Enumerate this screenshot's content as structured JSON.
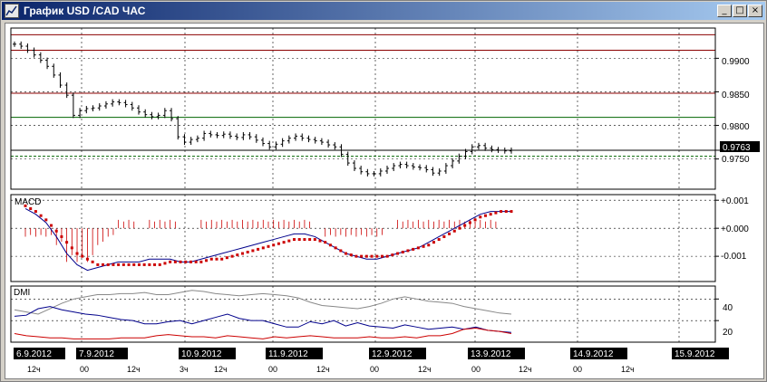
{
  "window": {
    "title": "График USD /CAD  ЧАС",
    "icons": [
      "chart-app-icon",
      "minimize-icon",
      "maximize-icon",
      "close-icon"
    ],
    "buttons": {
      "minimize": "_",
      "maximize": "□",
      "close": "×"
    }
  },
  "colors": {
    "titlebar_start": "#0a246a",
    "titlebar_end": "#a6caf0",
    "candle": "#000000",
    "resistance_line": "#8b0000",
    "support_line": "#006400",
    "macd_line": "#00008b",
    "macd_signal": "#cc0000",
    "dmi_adx": "#888888",
    "dmi_plus": "#00008b",
    "dmi_minus": "#cc0000"
  },
  "price_axis": {
    "labels": [
      "0.9900",
      "0.9850",
      "0.9800",
      "0.9750"
    ],
    "current_price": "0.9763"
  },
  "macd_panel": {
    "label": "MACD",
    "axis_labels": [
      "+0.001",
      "+0.000",
      "-0.001"
    ]
  },
  "dmi_panel": {
    "label": "DMI",
    "axis_labels": [
      "40",
      "20"
    ]
  },
  "date_labels": [
    "6.9.2012",
    "7.9.2012",
    "10.9.2012",
    "11.9.2012",
    "12.9.2012",
    "13.9.2012",
    "14.9.2012",
    "15.9.2012"
  ],
  "hour_labels": [
    "12ч",
    "00",
    "12ч",
    "3ч",
    "12ч",
    "00",
    "12ч",
    "00",
    "12ч",
    "00",
    "12ч",
    "00",
    "12ч"
  ],
  "chart_data": [
    {
      "type": "line",
      "title": "График USD /CAD  ЧАС",
      "xlabel": "",
      "ylabel": "",
      "ylim": [
        0.9705,
        0.9945
      ],
      "y_ticks": [
        0.99,
        0.985,
        0.98,
        0.975
      ],
      "current_value": 0.9763,
      "horizontal_levels": [
        0.9935,
        0.9912,
        0.9848,
        0.9812,
        0.9763,
        0.9754
      ],
      "close": [
        0.9921,
        0.9918,
        0.9912,
        0.9905,
        0.9897,
        0.9888,
        0.9875,
        0.986,
        0.9845,
        0.9815,
        0.9822,
        0.9825,
        0.9826,
        0.9829,
        0.9832,
        0.9835,
        0.9834,
        0.9831,
        0.9826,
        0.982,
        0.9816,
        0.9813,
        0.9815,
        0.9822,
        0.981,
        0.9783,
        0.9775,
        0.9779,
        0.9781,
        0.9788,
        0.9786,
        0.9785,
        0.9787,
        0.9784,
        0.9782,
        0.9786,
        0.9783,
        0.9778,
        0.9773,
        0.9768,
        0.9772,
        0.9777,
        0.9781,
        0.9784,
        0.9781,
        0.9779,
        0.9777,
        0.9775,
        0.9771,
        0.9768,
        0.9757,
        0.9744,
        0.9736,
        0.9731,
        0.9728,
        0.9728,
        0.9732,
        0.9736,
        0.974,
        0.9742,
        0.974,
        0.9738,
        0.9737,
        0.9734,
        0.9729,
        0.9732,
        0.974,
        0.9747,
        0.9754,
        0.9761,
        0.9768,
        0.977,
        0.9766,
        0.9764,
        0.9763,
        0.9762,
        0.9763
      ]
    },
    {
      "type": "line",
      "title": "MACD",
      "ylim": [
        -0.0019,
        0.0012
      ],
      "series": [
        {
          "values": [
            0.0007,
            0.0005,
            0.0002,
            -0.0003,
            -0.0009,
            -0.0013,
            -0.0015,
            -0.0014,
            -0.0013,
            -0.0012,
            -0.0012,
            -0.0012,
            -0.0011,
            -0.0011,
            -0.0011,
            -0.0012,
            -0.0012,
            -0.0011,
            -0.001,
            -0.0009,
            -0.0008,
            -0.0007,
            -0.0006,
            -0.0005,
            -0.0004,
            -0.0003,
            -0.0002,
            -0.0002,
            -0.0003,
            -0.0005,
            -0.0007,
            -0.0009,
            -0.001,
            -0.0011,
            -0.0011,
            -0.001,
            -0.0009,
            -0.0008,
            -0.0007,
            -0.0005,
            -0.0003,
            -0.0001,
            0.0001,
            0.0003,
            0.0005,
            0.0006,
            0.0006,
            0.0006
          ]
        },
        {
          "values": [
            0.0008,
            0.0006,
            0.0003,
            -0.0001,
            -0.0005,
            -0.0009,
            -0.0011,
            -0.0013,
            -0.0013,
            -0.0013,
            -0.0013,
            -0.0013,
            -0.0013,
            -0.0013,
            -0.0012,
            -0.0012,
            -0.0012,
            -0.0012,
            -0.0011,
            -0.0011,
            -0.001,
            -0.0009,
            -0.0008,
            -0.0007,
            -0.0006,
            -0.0005,
            -0.0004,
            -0.0004,
            -0.0004,
            -0.0005,
            -0.0007,
            -0.0009,
            -0.001,
            -0.001,
            -0.001,
            -0.001,
            -0.0009,
            -0.0008,
            -0.0007,
            -0.0006,
            -0.0004,
            -0.0002,
            0.0,
            0.0002,
            0.0004,
            0.0005,
            0.0006,
            0.0006
          ]
        }
      ],
      "histogram": [
        -0.0001,
        -0.0001,
        -0.0001,
        -0.0002,
        -0.0004,
        -0.0004,
        -0.0004,
        -0.0002,
        -0.0001,
        0.0001,
        0.0001,
        0.0,
        0.0001,
        0.0001,
        0.0001,
        0.0,
        0.0,
        0.0001,
        0.0001,
        0.0001,
        0.0001,
        0.0001,
        0.0001,
        0.0001,
        0.0001,
        0.0001,
        0.0001,
        0.0001,
        0.0,
        -0.0001,
        -0.0001,
        -0.0001,
        -0.0001,
        -0.0001,
        -0.0001,
        0.0,
        0.0001,
        0.0001,
        0.0001,
        0.0001,
        0.0001,
        0.0001,
        0.0001,
        0.0001,
        0.0001,
        0.0001,
        0.0,
        0.0
      ]
    },
    {
      "type": "line",
      "title": "DMI",
      "ylim": [
        0,
        52
      ],
      "y_ticks": [
        40,
        20
      ],
      "series": [
        {
          "values": [
            30,
            28,
            26,
            31,
            36,
            40,
            42,
            44,
            44,
            45,
            45,
            46,
            44,
            44,
            46,
            48,
            47,
            45,
            44,
            43,
            44,
            45,
            44,
            43,
            41,
            37,
            34,
            33,
            32,
            31,
            33,
            36,
            40,
            42,
            40,
            38,
            37,
            36,
            33,
            31,
            29,
            27,
            26
          ]
        },
        {
          "values": [
            24,
            25,
            31,
            33,
            30,
            28,
            26,
            25,
            23,
            21,
            20,
            17,
            17,
            19,
            20,
            17,
            20,
            23,
            26,
            22,
            20,
            20,
            17,
            14,
            14,
            19,
            17,
            20,
            15,
            18,
            15,
            14,
            13,
            16,
            14,
            12,
            13,
            14,
            12,
            14,
            11,
            10,
            9
          ]
        },
        {
          "values": [
            8,
            6,
            5,
            4,
            4,
            3,
            3,
            3,
            3,
            4,
            4,
            4,
            6,
            7,
            6,
            5,
            5,
            4,
            6,
            5,
            4,
            3,
            5,
            4,
            5,
            6,
            5,
            4,
            4,
            4,
            5,
            4,
            4,
            5,
            4,
            6,
            6,
            8,
            12,
            13,
            11,
            10,
            8
          ]
        }
      ]
    }
  ]
}
